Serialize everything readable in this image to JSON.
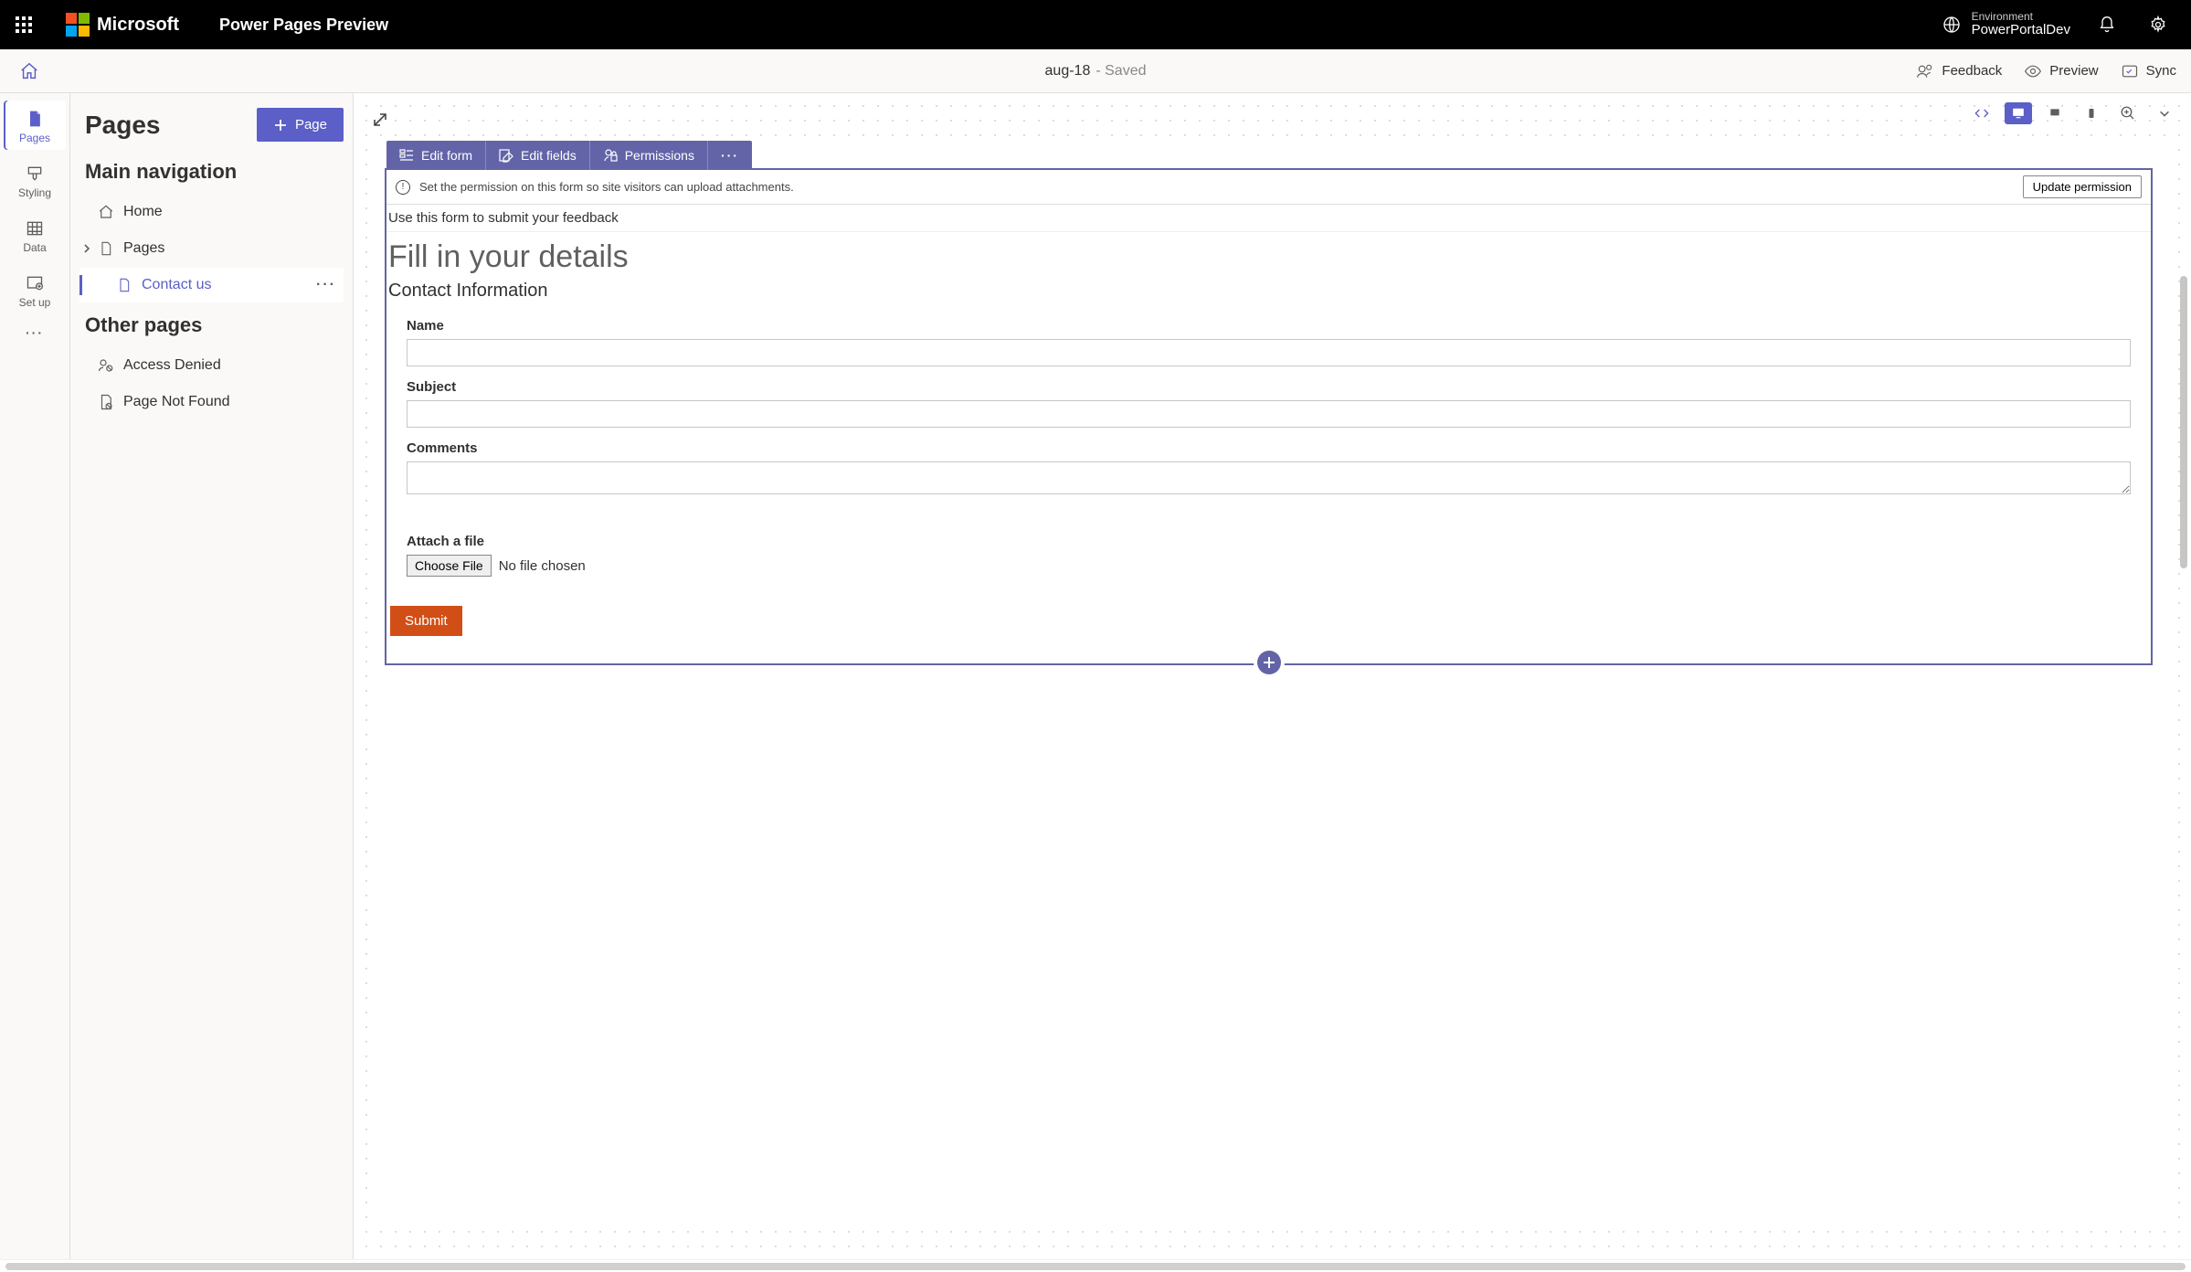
{
  "header": {
    "brand": "Microsoft",
    "app_name": "Power Pages Preview",
    "environment_label": "Environment",
    "environment_name": "PowerPortalDev"
  },
  "command_bar": {
    "doc_name": "aug-18",
    "doc_status": "- Saved",
    "feedback": "Feedback",
    "preview": "Preview",
    "sync": "Sync"
  },
  "left_rail": {
    "pages": "Pages",
    "styling": "Styling",
    "data": "Data",
    "setup": "Set up"
  },
  "pages_panel": {
    "title": "Pages",
    "new_page_btn": "Page",
    "main_nav": "Main navigation",
    "other_pages": "Other pages",
    "items": {
      "home": "Home",
      "pages": "Pages",
      "contact_us": "Contact us",
      "access_denied": "Access Denied",
      "not_found": "Page Not Found"
    }
  },
  "form_bar": {
    "edit_form": "Edit form",
    "edit_fields": "Edit fields",
    "permissions": "Permissions"
  },
  "perm_banner": {
    "text": "Set the permission on this form so site visitors can upload attachments.",
    "button": "Update permission"
  },
  "form": {
    "intro": "Use this form to submit your feedback",
    "title": "Fill in your details",
    "section": "Contact Information",
    "name_label": "Name",
    "subject_label": "Subject",
    "comments_label": "Comments",
    "attach_label": "Attach a file",
    "choose_file": "Choose File",
    "no_file": "No file chosen",
    "submit": "Submit"
  }
}
